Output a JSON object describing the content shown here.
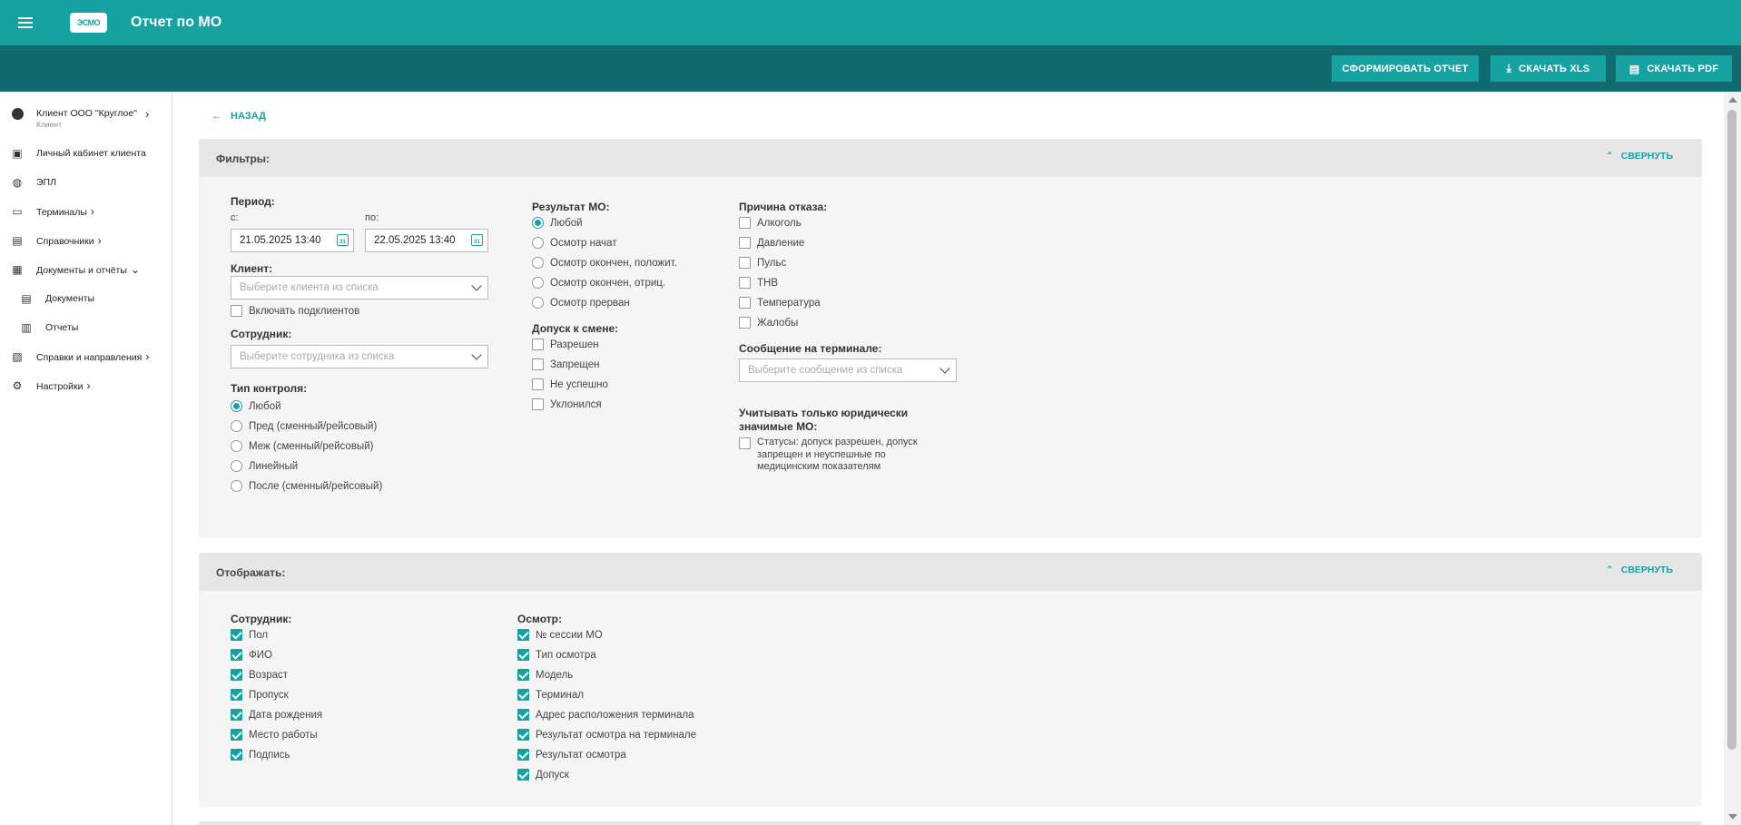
{
  "app": {
    "title": "Отчет по МО",
    "logo": "ЭСМО"
  },
  "actions": {
    "generate": "СФОРМИРОВАТЬ ОТЧЕТ",
    "xls": "СКАЧАТЬ XLS",
    "pdf": "СКАЧАТЬ PDF"
  },
  "sidebar": {
    "client_name": "Клиент ООО \"Круглое\"",
    "client_role": "Клиент",
    "items": [
      {
        "label": "Личный кабинет клиента"
      },
      {
        "label": "ЭПЛ"
      },
      {
        "label": "Терминалы"
      },
      {
        "label": "Справочники"
      },
      {
        "label": "Документы и отчёты"
      },
      {
        "label": "Документы"
      },
      {
        "label": "Отчеты"
      },
      {
        "label": "Справки и направления"
      },
      {
        "label": "Настройки"
      }
    ]
  },
  "nav": {
    "back": "НАЗАД"
  },
  "filters": {
    "title": "Фильтры:",
    "collapse": "СВЕРНУТЬ",
    "period_label": "Период:",
    "from_label": "с:",
    "to_label": "по:",
    "from_value": "21.05.2025 13:40",
    "to_value": "22.05.2025 13:40",
    "client_label": "Клиент:",
    "client_placeholder": "Выберите клиента из списка",
    "include_subclients": "Включать подклиентов",
    "employee_label": "Сотрудник:",
    "employee_placeholder": "Выберите сотрудника из списка",
    "control_type_label": "Тип контроля:",
    "control_types": [
      "Любой",
      "Пред (сменный/рейсовый)",
      "Меж (сменный/рейсовый)",
      "Линейный",
      "После (сменный/рейсовый)"
    ],
    "result_label": "Результат МО:",
    "results": [
      "Любой",
      "Осмотр начат",
      "Осмотр окончен, положит.",
      "Осмотр окончен, отриц.",
      "Осмотр прерван"
    ],
    "admission_label": "Допуск к смене:",
    "admissions": [
      "Разрешен",
      "Запрещен",
      "Не успешно",
      "Уклонился"
    ],
    "reason_label": "Причина отказа:",
    "reasons": [
      "Алкоголь",
      "Давление",
      "Пульс",
      "ТНВ",
      "Температура",
      "Жалобы"
    ],
    "terminal_msg_label": "Сообщение на терминале:",
    "terminal_msg_placeholder": "Выберите сообщение из списка",
    "legal_label_1": "Учитывать только юридически",
    "legal_label_2": "значимые МО:",
    "legal_text_1": "Статусы: допуск разрешен, допуск",
    "legal_text_2": "запрещен и неуспешные по",
    "legal_text_3": "медицинским показателям"
  },
  "display": {
    "title": "Отображать:",
    "collapse": "СВЕРНУТЬ",
    "employee_label": "Сотрудник:",
    "employee_fields": [
      "Пол",
      "ФИО",
      "Возраст",
      "Пропуск",
      "Дата рождения",
      "Место работы",
      "Подпись"
    ],
    "exam_label": "Осмотр:",
    "exam_fields": [
      "№ сессии МО",
      "Тип осмотра",
      "Модель",
      "Терминал",
      "Адрес расположения терминала",
      "Результат осмотра на терминале",
      "Результат осмотра",
      "Допуск"
    ]
  },
  "colors": {
    "primary": "#17a2a2",
    "dark": "#116b6e"
  }
}
